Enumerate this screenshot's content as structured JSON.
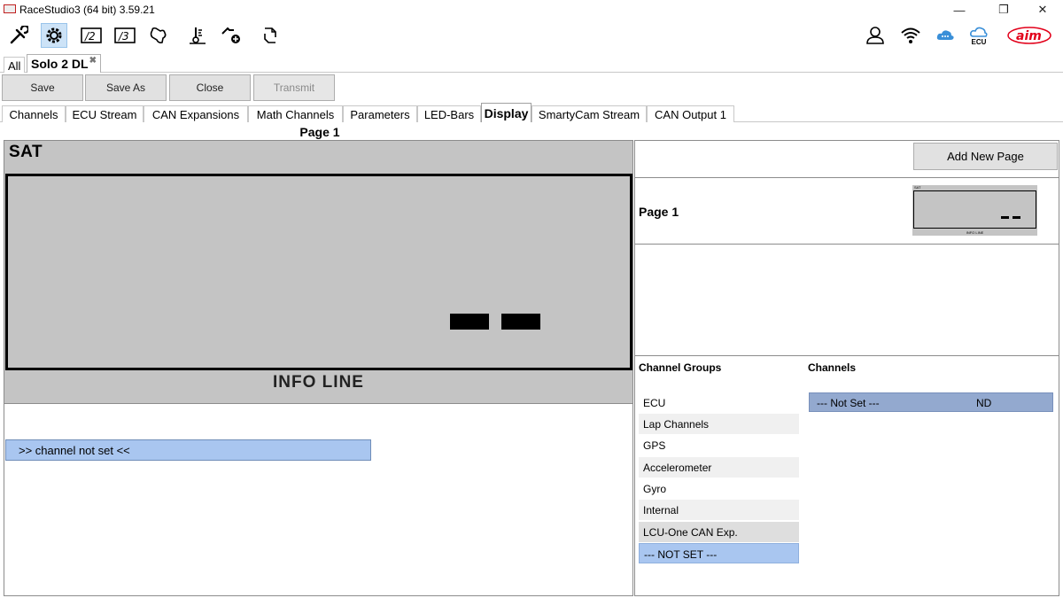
{
  "window": {
    "title": "RaceStudio3 (64 bit) 3.59.21",
    "minimize": "—",
    "restore": "❐",
    "close": "✕"
  },
  "toolbar": {
    "icons": [
      "wrench-icon",
      "gear-icon",
      "config-v2-icon",
      "config-v3-icon",
      "track-icon",
      "tools-icon",
      "add-device-icon",
      "transfer-icon"
    ],
    "right_icons": [
      "user-icon",
      "wifi-icon",
      "cloud-icon",
      "ecu-icon",
      "aim-logo"
    ],
    "ecu_label": "ECU",
    "logo_text": "aim"
  },
  "device_tabs": {
    "all_label": "All",
    "device_label": "Solo 2 DL",
    "close_glyph": "✖"
  },
  "actions": {
    "save": "Save",
    "save_as": "Save As",
    "close": "Close",
    "transmit": "Transmit"
  },
  "section_tabs": [
    "Channels",
    "ECU Stream",
    "CAN Expansions",
    "Math Channels",
    "Parameters",
    "LED-Bars",
    "Display",
    "SmartyCam Stream",
    "CAN Output 1"
  ],
  "active_tab": "Display",
  "editor": {
    "page_title": "Page 1",
    "sat_label": "SAT",
    "info_line": "INFO LINE",
    "channel_slot": ">>  channel not set  <<"
  },
  "pages": {
    "add_button": "Add New Page",
    "items": [
      {
        "label": "Page 1",
        "thumb_top": "SAT",
        "thumb_bottom": "INFO LINE"
      }
    ]
  },
  "channel_groups": {
    "header": "Channel Groups",
    "items": [
      "ECU",
      "Lap Channels",
      "GPS",
      "Accelerometer",
      "Gyro",
      "Internal",
      "LCU-One CAN Exp.",
      "--- NOT SET ---"
    ],
    "selected": "--- NOT SET ---"
  },
  "channels": {
    "header": "Channels",
    "rows": [
      {
        "name": "--- Not Set ---",
        "value": "ND"
      }
    ]
  },
  "colors": {
    "display_bg": "#c4c4c4",
    "selection": "#a9c6f0",
    "channel_row": "#93a9cf",
    "active_toolbar": "#cde3f7",
    "aim_red": "#e2001a"
  }
}
